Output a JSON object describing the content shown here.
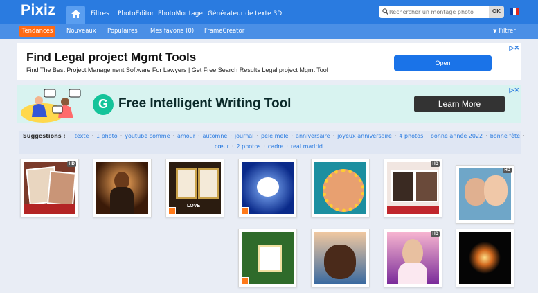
{
  "logo": {
    "text": "Pixiz"
  },
  "nav": {
    "items": [
      "Filtres",
      "PhotoEditor",
      "PhotoMontage",
      "Générateur de texte 3D"
    ],
    "search_placeholder": "Rechercher un montage photo",
    "search_button": "OK"
  },
  "subnav": {
    "active": "Tendances",
    "items": [
      "Nouveaux",
      "Populaires",
      "Mes favoris (0)",
      "FrameCreator"
    ],
    "filter": "Filtrer"
  },
  "ad1": {
    "headline": "Find Legal project Mgmt Tools",
    "text": "Find The Best Project Management Software For Lawyers | Get Free Search Results Legal project Mgmt Tool",
    "button": "Open"
  },
  "ad2": {
    "headline": "Free Intelligent Writing Tool",
    "button": "Learn More"
  },
  "suggestions": {
    "label": "Suggestions :",
    "line1": [
      "texte",
      "1 photo",
      "youtube comme",
      "amour",
      "automne",
      "journal",
      "pele mele",
      "anniversaire",
      "joyeux anniversaire",
      "4 photos",
      "bonne année 2022",
      "bonne fête"
    ],
    "line2": [
      "cœur",
      "2 photos",
      "cadre",
      "real madrid"
    ]
  },
  "thumbs": {
    "hd_label": "HD",
    "frame_caption": "LOVE",
    "row1": [
      {
        "hd": true,
        "avatar": false,
        "kind": "collage"
      },
      {
        "hd": false,
        "avatar": false,
        "kind": "sparkle-girl"
      },
      {
        "hd": false,
        "avatar": true,
        "kind": "double-frame"
      },
      {
        "hd": false,
        "avatar": true,
        "kind": "blue-heart"
      },
      {
        "hd": false,
        "avatar": false,
        "kind": "circle-frame"
      },
      {
        "hd": true,
        "avatar": false,
        "kind": "couple-frames"
      },
      {
        "hd": true,
        "avatar": false,
        "kind": "couple-closeup"
      }
    ],
    "row2": [
      {
        "hd": false,
        "avatar": true,
        "kind": "flower-frame"
      },
      {
        "hd": false,
        "avatar": false,
        "kind": "couple-hug"
      },
      {
        "hd": true,
        "avatar": false,
        "kind": "pink-girl"
      },
      {
        "hd": false,
        "avatar": false,
        "kind": "fireworks"
      }
    ]
  }
}
